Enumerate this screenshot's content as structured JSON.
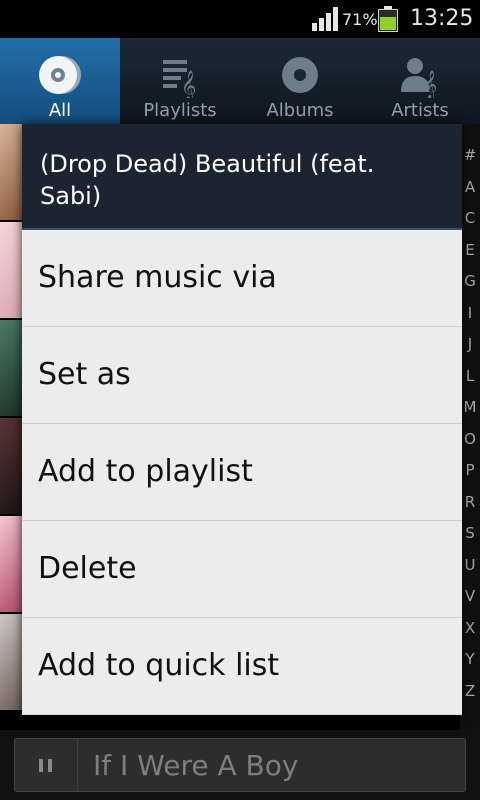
{
  "status_bar": {
    "battery_percent": "71%",
    "battery_level": 0.71,
    "battery_color": "#8ed12c",
    "time": "13:25",
    "signal_icon": "signal-bars-icon"
  },
  "tabs": [
    {
      "label": "All",
      "icon": "disc-icon",
      "active": true
    },
    {
      "label": "Playlists",
      "icon": "playlist-icon",
      "active": false
    },
    {
      "label": "Albums",
      "icon": "album-icon",
      "active": false
    },
    {
      "label": "Artists",
      "icon": "artist-icon",
      "active": false
    }
  ],
  "index_letters": [
    "#",
    "A",
    "C",
    "E",
    "G",
    "I",
    "J",
    "L",
    "M",
    "O",
    "P",
    "R",
    "S",
    "U",
    "V",
    "X",
    "Y",
    "Z"
  ],
  "dialog": {
    "title": "(Drop Dead) Beautiful (feat. Sabi)",
    "items": [
      "Share music via",
      "Set as",
      "Add to playlist",
      "Delete",
      "Add to quick list"
    ]
  },
  "player": {
    "title": "If I Were A Boy",
    "pause_icon": "pause-icon"
  },
  "colors": {
    "tab_active": "#236ea9",
    "dialog_header": "#1b2431",
    "menu_bg": "#ececec"
  }
}
